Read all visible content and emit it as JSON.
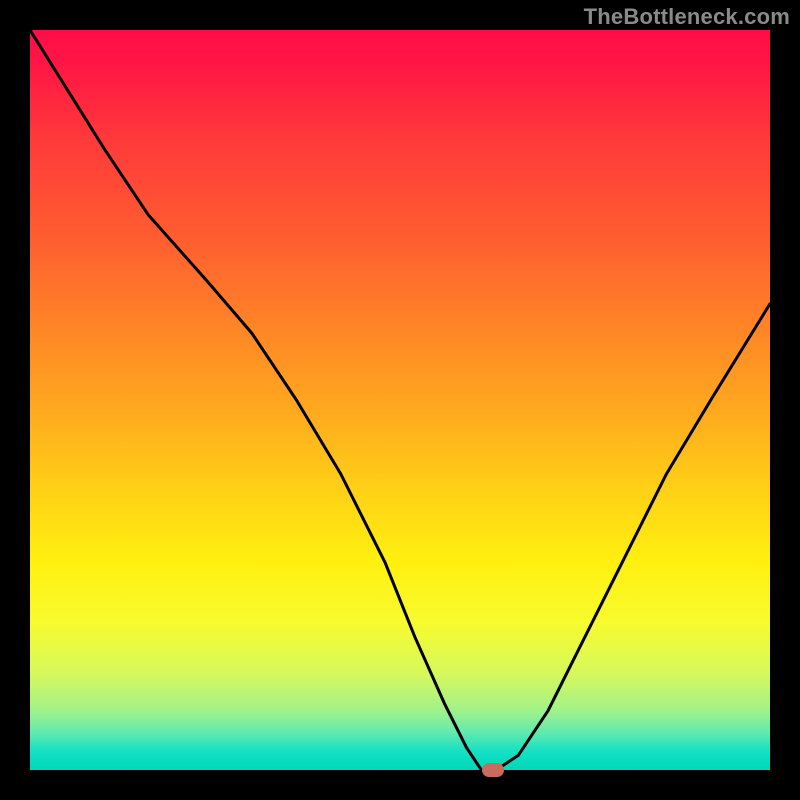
{
  "watermark": "TheBottleneck.com",
  "chart_data": {
    "type": "line",
    "title": "",
    "xlabel": "",
    "ylabel": "",
    "xlim": [
      0,
      100
    ],
    "ylim": [
      0,
      100
    ],
    "grid": false,
    "legend": false,
    "background_gradient": {
      "orientation": "vertical",
      "stops": [
        {
          "pos": 0.0,
          "color": "#ff0d48"
        },
        {
          "pos": 0.15,
          "color": "#ff3a3a"
        },
        {
          "pos": 0.4,
          "color": "#ff8427"
        },
        {
          "pos": 0.62,
          "color": "#ffd016"
        },
        {
          "pos": 0.8,
          "color": "#f8fb2e"
        },
        {
          "pos": 0.92,
          "color": "#a0f28b"
        },
        {
          "pos": 1.0,
          "color": "#00d8b8"
        }
      ]
    },
    "series": [
      {
        "name": "bottleneck-curve",
        "color": "#000000",
        "stroke_width": 2,
        "x": [
          0,
          5,
          10,
          16,
          24,
          30,
          36,
          42,
          48,
          52,
          56,
          59,
          61,
          63,
          66,
          70,
          74,
          80,
          86,
          92,
          100
        ],
        "y": [
          100,
          92,
          84,
          75,
          66,
          59,
          50,
          40,
          28,
          18,
          9,
          3,
          0,
          0,
          2,
          8,
          16,
          28,
          40,
          50,
          63
        ]
      }
    ],
    "marker": {
      "name": "optimal-point",
      "x": 62.5,
      "y": 0,
      "color": "#c96b5e",
      "shape": "rounded-rect"
    }
  }
}
